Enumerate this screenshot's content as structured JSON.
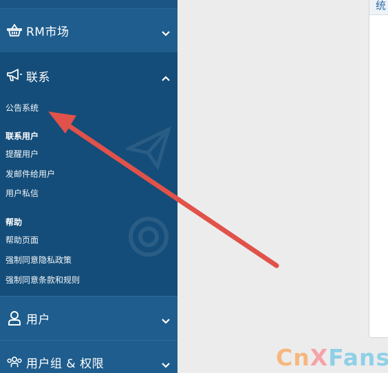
{
  "sidebar": {
    "rm_market": {
      "label": "RM市场",
      "icon": "basket-icon"
    },
    "contact": {
      "label": "联系",
      "icon": "megaphone-icon",
      "items": {
        "announcements": "公告系统",
        "group_contact_users": "联系用户",
        "remind_users": "提醒用户",
        "email_users": "发邮件给用户",
        "private_message": "用户私信",
        "group_help": "帮助",
        "help_pages": "帮助页面",
        "force_privacy": "强制同意隐私政策",
        "force_terms": "强制同意条款和规则"
      }
    },
    "users": {
      "label": "用户",
      "icon": "user-icon"
    },
    "groups": {
      "label": "用户组 & 权限",
      "icon": "users-group-icon"
    }
  },
  "content": {
    "panel_title": "统"
  },
  "watermark": {
    "c": "Cn",
    "x": "X",
    "f": "Fans"
  },
  "colors": {
    "sidebar_bg": "#1d5b8a",
    "open_panel_bg": "#144d79",
    "arrow": "#e0524a"
  }
}
